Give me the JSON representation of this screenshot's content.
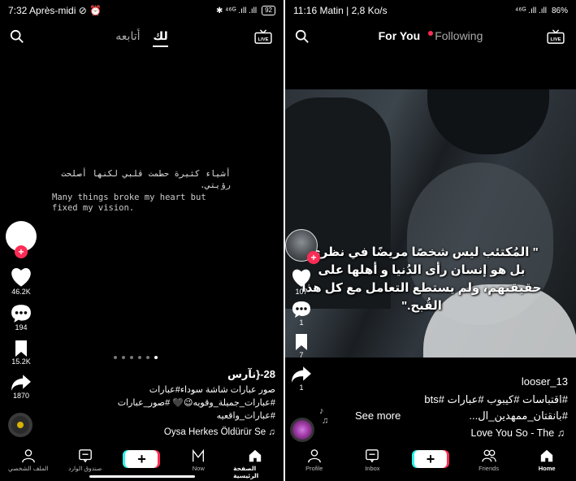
{
  "left": {
    "status": {
      "time": "7:32 Après-midi",
      "icons": "⊘ ⏰",
      "right": "✱ ⁴⁶ᴳ .ıll .ıll",
      "battery": "92"
    },
    "tabs": {
      "following": "أتابعه",
      "for_you": "لك"
    },
    "quote_arabic": "أشياء كثيرة حطمت قلبي لكنها أصلحت رؤيتي.",
    "quote_english": "Many things broke my heart but fixed my vision.",
    "likes": "46.2K",
    "comments": "194",
    "saves": "15.2K",
    "shares": "1870",
    "username": "28-{ﻧﺂﺭﺱ",
    "caption_line1": "صور عبارات شاشة سوداء#عبارات",
    "caption_line2": "#عبارات_جميلة_وقويه😉🖤 #صور_عبارات",
    "caption_line3": "#عبارات_واقعيه",
    "music": "Oysa Herkes Öldürür Se ♫",
    "nav": {
      "home": "الصفحة الرئيسية",
      "now": "Now",
      "inbox": "صندوق الوارد",
      "profile": "الملف الشخصي"
    }
  },
  "right": {
    "status": {
      "time": "11:16 Matin | 2,8 Ko/s",
      "right": "⁴⁶ᴳ .ıll .ıll",
      "battery": "86%"
    },
    "tabs": {
      "for_you": "For You",
      "following": "Following"
    },
    "quote": "\" المُكتئب ليس شخصًا مريضًا في نظري، بل هو إنسان رأى الدُنيا و أهلها على حقيقتهم، ولم يستطع التعامل مع كل هذا القُبح.\"",
    "likes": "107",
    "comments": "1",
    "saves": "7",
    "shares": "1",
    "username": "looser_13",
    "hashtags1": "#اقتباسات #كيبوب #عبارات #bts",
    "see_more": "See more",
    "hashtags2": "#بانقتان_ممهدين_ال...",
    "music": "Love You So - The ♫",
    "nav": {
      "home": "Home",
      "friends": "Friends",
      "inbox": "Inbox",
      "profile": "Profile"
    }
  },
  "colors": {
    "accent_red": "#fe2c55",
    "accent_cyan": "#25f4ee",
    "background": "#000000"
  }
}
